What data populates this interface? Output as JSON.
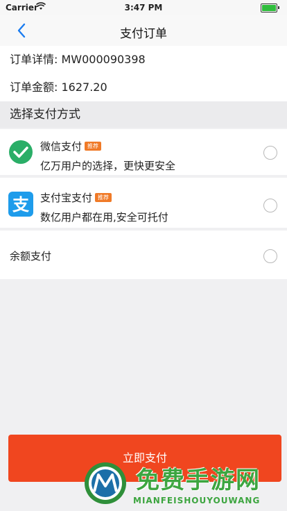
{
  "status": {
    "carrier": "Carrier",
    "time": "3:47 PM"
  },
  "nav": {
    "title": "支付订单"
  },
  "order": {
    "detail": "订单详情: MW000090398",
    "amount": "订单金额: 1627.20"
  },
  "section": {
    "title": "选择支付方式"
  },
  "methods": [
    {
      "name": "微信支付",
      "tag": "推荐",
      "desc": "亿万用户的选择，更快更安全",
      "icon": "wechat-pay-icon",
      "color": "#2aae67"
    },
    {
      "name": "支付宝支付",
      "tag": "推荐",
      "desc": "数亿用户都在用,安全可托付",
      "icon": "alipay-icon",
      "color": "#1e9ceb"
    },
    {
      "name": "余额支付"
    }
  ],
  "button": {
    "label": "立即支付",
    "color": "#f0461f"
  },
  "watermark": {
    "text": "免费手游网",
    "sub": "MIANFEISHOUYOUWANG"
  }
}
